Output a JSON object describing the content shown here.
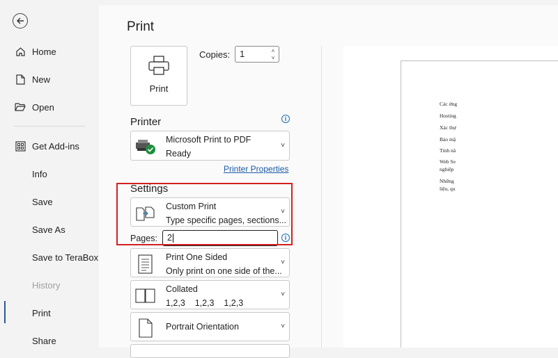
{
  "sidebar": {
    "back_label": "Back",
    "items": [
      {
        "label": "Home",
        "icon": "home-icon"
      },
      {
        "label": "New",
        "icon": "new-document-icon"
      },
      {
        "label": "Open",
        "icon": "open-folder-icon"
      },
      {
        "label": "Get Add-ins",
        "icon": "add-ins-icon"
      },
      {
        "label": "Info"
      },
      {
        "label": "Save"
      },
      {
        "label": "Save As"
      },
      {
        "label": "Save to TeraBox"
      },
      {
        "label": "History",
        "disabled": true
      },
      {
        "label": "Print",
        "active": true
      },
      {
        "label": "Share"
      }
    ]
  },
  "print": {
    "title": "Print",
    "button_label": "Print",
    "copies_label": "Copies:",
    "copies_value": "1"
  },
  "printer": {
    "section_title": "Printer",
    "name": "Microsoft Print to PDF",
    "status": "Ready",
    "properties_link": "Printer Properties"
  },
  "settings": {
    "section_title": "Settings",
    "range": {
      "title": "Custom Print",
      "subtitle": "Type specific pages, sections..."
    },
    "pages_label": "Pages:",
    "pages_value": "2",
    "sides": {
      "title": "Print One Sided",
      "subtitle": "Only print on one side of the..."
    },
    "collation": {
      "title": "Collated",
      "subtitle": "1,2,3    1,2,3    1,2,3"
    },
    "orientation": {
      "title": "Portrait Orientation"
    }
  },
  "preview": {
    "lines": [
      "Các ứng",
      "Hosting",
      "Xác thự",
      "Bảo mậ",
      "Tính nă",
      "Web Se",
      "nghiệp",
      "Những",
      "liệu, qu"
    ]
  },
  "colors": {
    "accent": "#2b5797",
    "highlight": "#d42020",
    "link": "#1a5aa6"
  }
}
